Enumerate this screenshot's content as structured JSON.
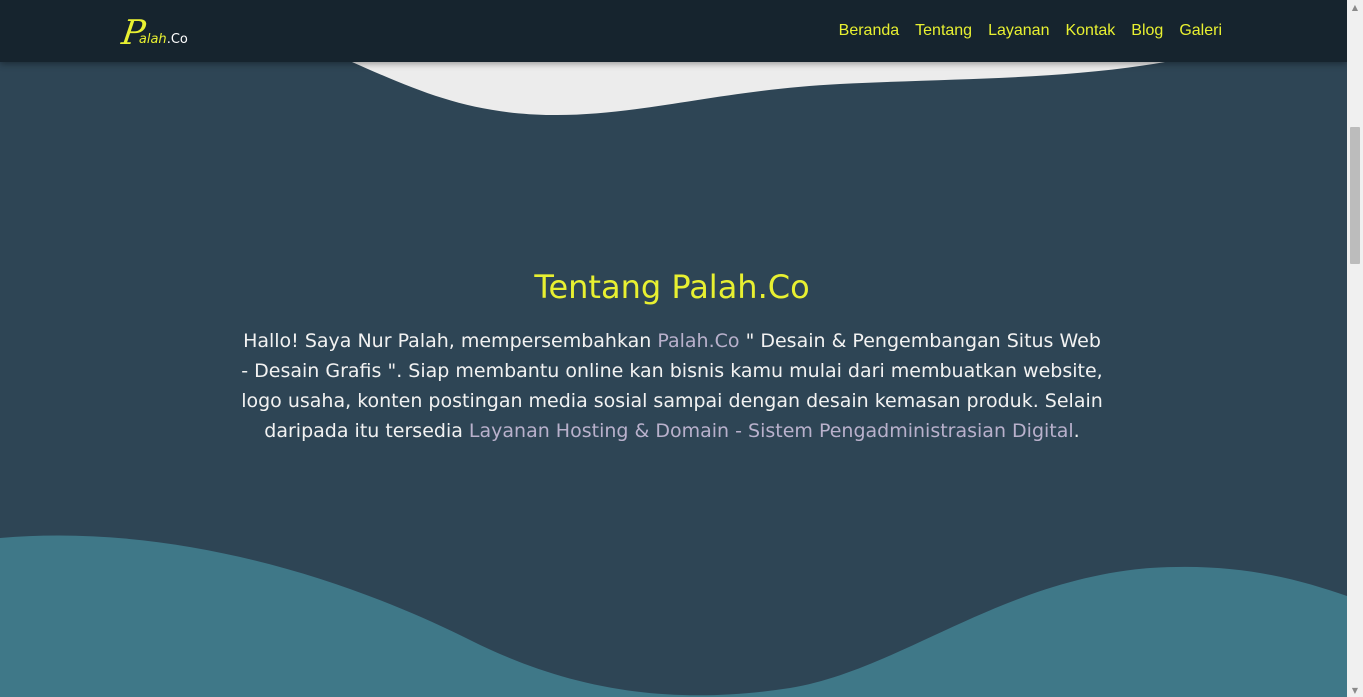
{
  "brand": {
    "logo_initial": "P",
    "logo_rest_a": "alah",
    "logo_rest_b": ".Co"
  },
  "nav": [
    {
      "label": "Beranda"
    },
    {
      "label": "Tentang"
    },
    {
      "label": "Layanan"
    },
    {
      "label": "Kontak"
    },
    {
      "label": "Blog"
    },
    {
      "label": "Galeri"
    }
  ],
  "about": {
    "title": "Tentang Palah.Co",
    "text_1": "Hallo! Saya Nur Palah, mempersembahkan ",
    "link_brand": "Palah.Co",
    "text_2": " \" Desain & Pengembangan Situs Web - Desain Grafis \". Siap membantu online kan bisnis kamu mulai dari membuatkan website, logo usaha, konten postingan media sosial sampai dengan desain kemasan produk. Selain daripada itu tersedia ",
    "link_hosting": "Layanan Hosting & Domain",
    "text_3": " - ",
    "link_admin": "Sistem Pengadministrasian Digital",
    "text_4": "."
  },
  "colors": {
    "navbar": "#16242e",
    "section_bg": "#2e4555",
    "accent_yellow": "#e8f031",
    "wave_light": "#ececec",
    "wave_teal": "#3f7888",
    "link_muted": "#b9b1cc"
  },
  "scrollbar": {
    "up_icon": "triangle-up",
    "down_icon": "triangle-down"
  }
}
